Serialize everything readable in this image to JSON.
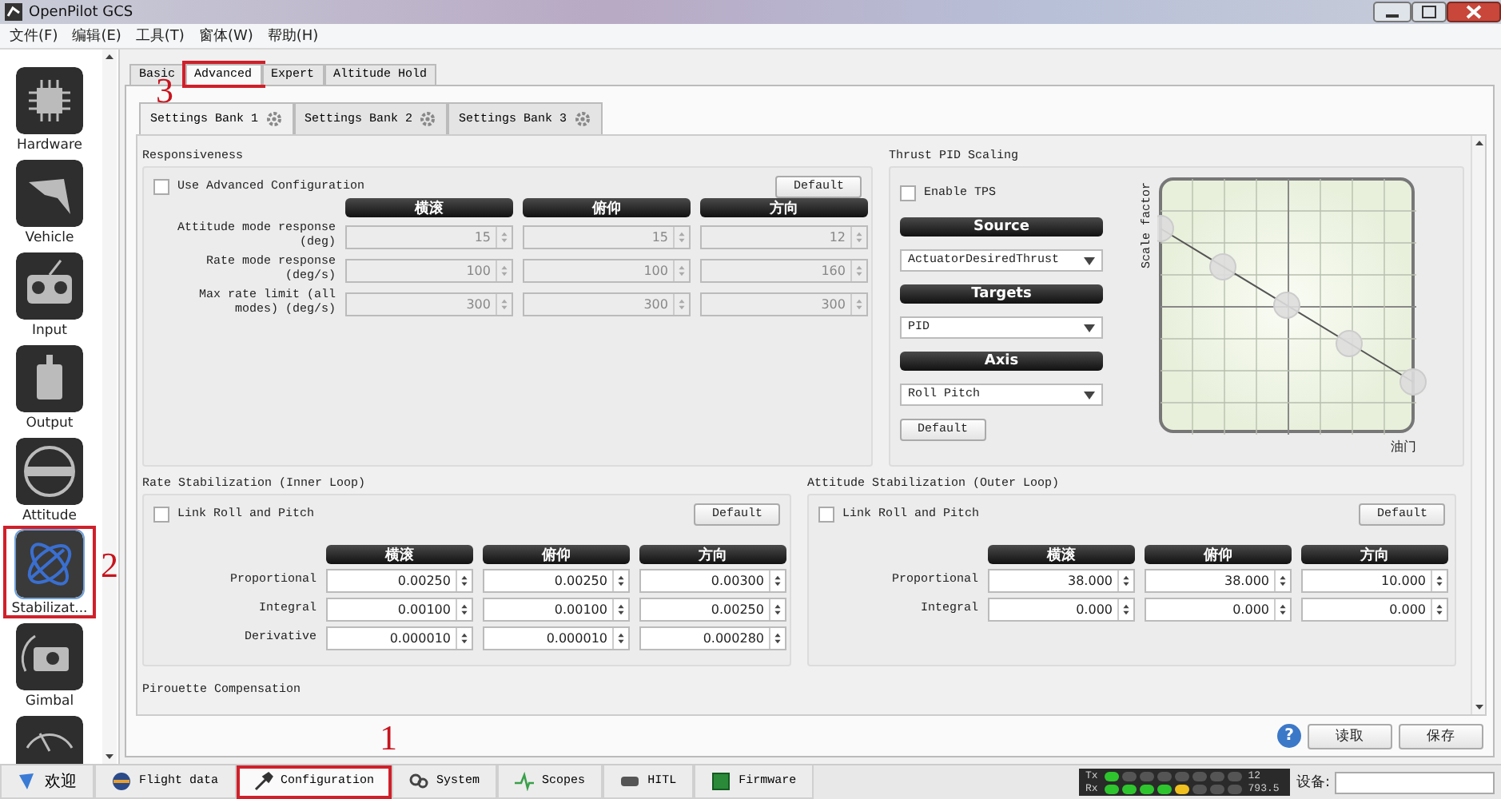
{
  "window": {
    "title": "OpenPilot GCS"
  },
  "menu": [
    "文件(F)",
    "编辑(E)",
    "工具(T)",
    "窗体(W)",
    "帮助(H)"
  ],
  "sidebar": {
    "items": [
      {
        "label": "Hardware",
        "selected": false
      },
      {
        "label": "Vehicle",
        "selected": false
      },
      {
        "label": "Input",
        "selected": false
      },
      {
        "label": "Output",
        "selected": false
      },
      {
        "label": "Attitude",
        "selected": false
      },
      {
        "label": "Stabilizat...",
        "selected": true,
        "callout": "2"
      },
      {
        "label": "Gimbal",
        "selected": false
      },
      {
        "selected": false
      }
    ]
  },
  "tabs": [
    {
      "label": "Basic",
      "selected": false
    },
    {
      "label": "Advanced",
      "selected": true,
      "callout": "3"
    },
    {
      "label": "Expert",
      "selected": false
    },
    {
      "label": "Altitude Hold",
      "selected": false
    }
  ],
  "bank_tabs": [
    {
      "label": "Settings Bank 1",
      "selected": true
    },
    {
      "label": "Settings Bank 2",
      "selected": false
    },
    {
      "label": "Settings Bank 3",
      "selected": false
    }
  ],
  "responsiveness": {
    "title": "Responsiveness",
    "checkbox": {
      "label": "Use Advanced Configuration",
      "checked": false
    },
    "default_button": "Default",
    "disabled": true,
    "columns": [
      "横滚",
      "俯仰",
      "方向"
    ],
    "rows": [
      {
        "label": "Attitude mode response (deg)",
        "values": [
          "15",
          "15",
          "12"
        ]
      },
      {
        "label": "Rate mode response (deg/s)",
        "values": [
          "100",
          "100",
          "160"
        ]
      },
      {
        "label": "Max rate limit (all modes) (deg/s)",
        "values": [
          "300",
          "300",
          "300"
        ]
      }
    ]
  },
  "thrust_pid_scaling": {
    "title": "Thrust PID Scaling",
    "checkbox": {
      "label": "Enable TPS",
      "checked": false
    },
    "selectors": [
      {
        "header": "Source",
        "value": "ActuatorDesiredThrust"
      },
      {
        "header": "Targets",
        "value": "PID"
      },
      {
        "header": "Axis",
        "value": "Roll Pitch"
      }
    ],
    "default_button": "Default",
    "y_axis_label": "Scale factor",
    "x_axis_label": "油门"
  },
  "rate_stabilization": {
    "title": "Rate Stabilization (Inner Loop)",
    "checkbox": {
      "label": "Link Roll and Pitch",
      "checked": false
    },
    "default_button": "Default",
    "disabled": false,
    "columns": [
      "横滚",
      "俯仰",
      "方向"
    ],
    "rows": [
      {
        "label": "Proportional",
        "values": [
          "0.00250",
          "0.00250",
          "0.00300"
        ]
      },
      {
        "label": "Integral",
        "values": [
          "0.00100",
          "0.00100",
          "0.00250"
        ]
      },
      {
        "label": "Derivative",
        "values": [
          "0.000010",
          "0.000010",
          "0.000280"
        ]
      }
    ]
  },
  "attitude_stabilization": {
    "title": "Attitude Stabilization (Outer Loop)",
    "checkbox": {
      "label": "Link Roll and Pitch",
      "checked": false
    },
    "default_button": "Default",
    "disabled": false,
    "columns": [
      "横滚",
      "俯仰",
      "方向"
    ],
    "rows": [
      {
        "label": "Proportional",
        "values": [
          "38.000",
          "38.000",
          "10.000"
        ]
      },
      {
        "label": "Integral",
        "values": [
          "0.000",
          "0.000",
          "0.000"
        ]
      }
    ]
  },
  "pirouette": {
    "title": "Pirouette Compensation"
  },
  "help": "?",
  "footer_buttons": [
    "读取",
    "保存"
  ],
  "bottom_tabs": [
    {
      "label": "欢迎",
      "selected": false
    },
    {
      "label": "Flight data",
      "selected": false
    },
    {
      "label": "Configuration",
      "selected": true,
      "callout": "1"
    },
    {
      "label": "System",
      "selected": false
    },
    {
      "label": "Scopes",
      "selected": false
    },
    {
      "label": "HITL",
      "selected": false
    },
    {
      "label": "Firmware",
      "selected": false
    }
  ],
  "telemetry": {
    "tx": {
      "label": "Tx",
      "level": 0.125,
      "reading": "12"
    },
    "rx": {
      "label": "Rx",
      "level": 0.625,
      "reading": "793.5"
    }
  },
  "device": {
    "label": "设备:"
  }
}
